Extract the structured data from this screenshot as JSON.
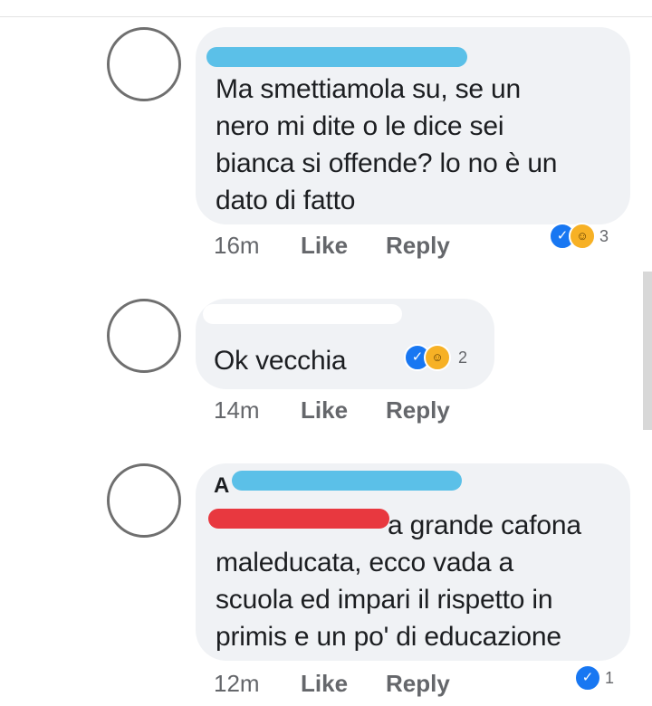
{
  "colors": {
    "bubble": "#f0f2f5",
    "meta": "#65676b",
    "like_blue": "#1877f2",
    "haha_yellow": "#f7b125",
    "blur_blue": "#5bc0e8",
    "blur_red": "#e8383f",
    "blur_white": "#ffffff"
  },
  "comments": [
    {
      "text": "Ma smettiamola su, se un\nnero mi dite o le dice sei\nbianca si offende? lo no è un\ndato di fatto",
      "time": "16m",
      "like_label": "Like",
      "reply_label": "Reply",
      "reaction_icons": [
        "like-icon",
        "haha-icon"
      ],
      "reaction_count": "3"
    },
    {
      "text": "Ok vecchia",
      "time": "14m",
      "like_label": "Like",
      "reply_label": "Reply",
      "reaction_icons": [
        "like-icon",
        "haha-icon"
      ],
      "reaction_count": "2"
    },
    {
      "name_fragment": "A",
      "text": "a grande cafona\nmaleducata, ecco vada a\nscuola ed impari il rispetto in\nprimis e un po' di educazione",
      "time": "12m",
      "like_label": "Like",
      "reply_label": "Reply",
      "reaction_icons": [
        "like-icon"
      ],
      "reaction_count": "1"
    }
  ]
}
